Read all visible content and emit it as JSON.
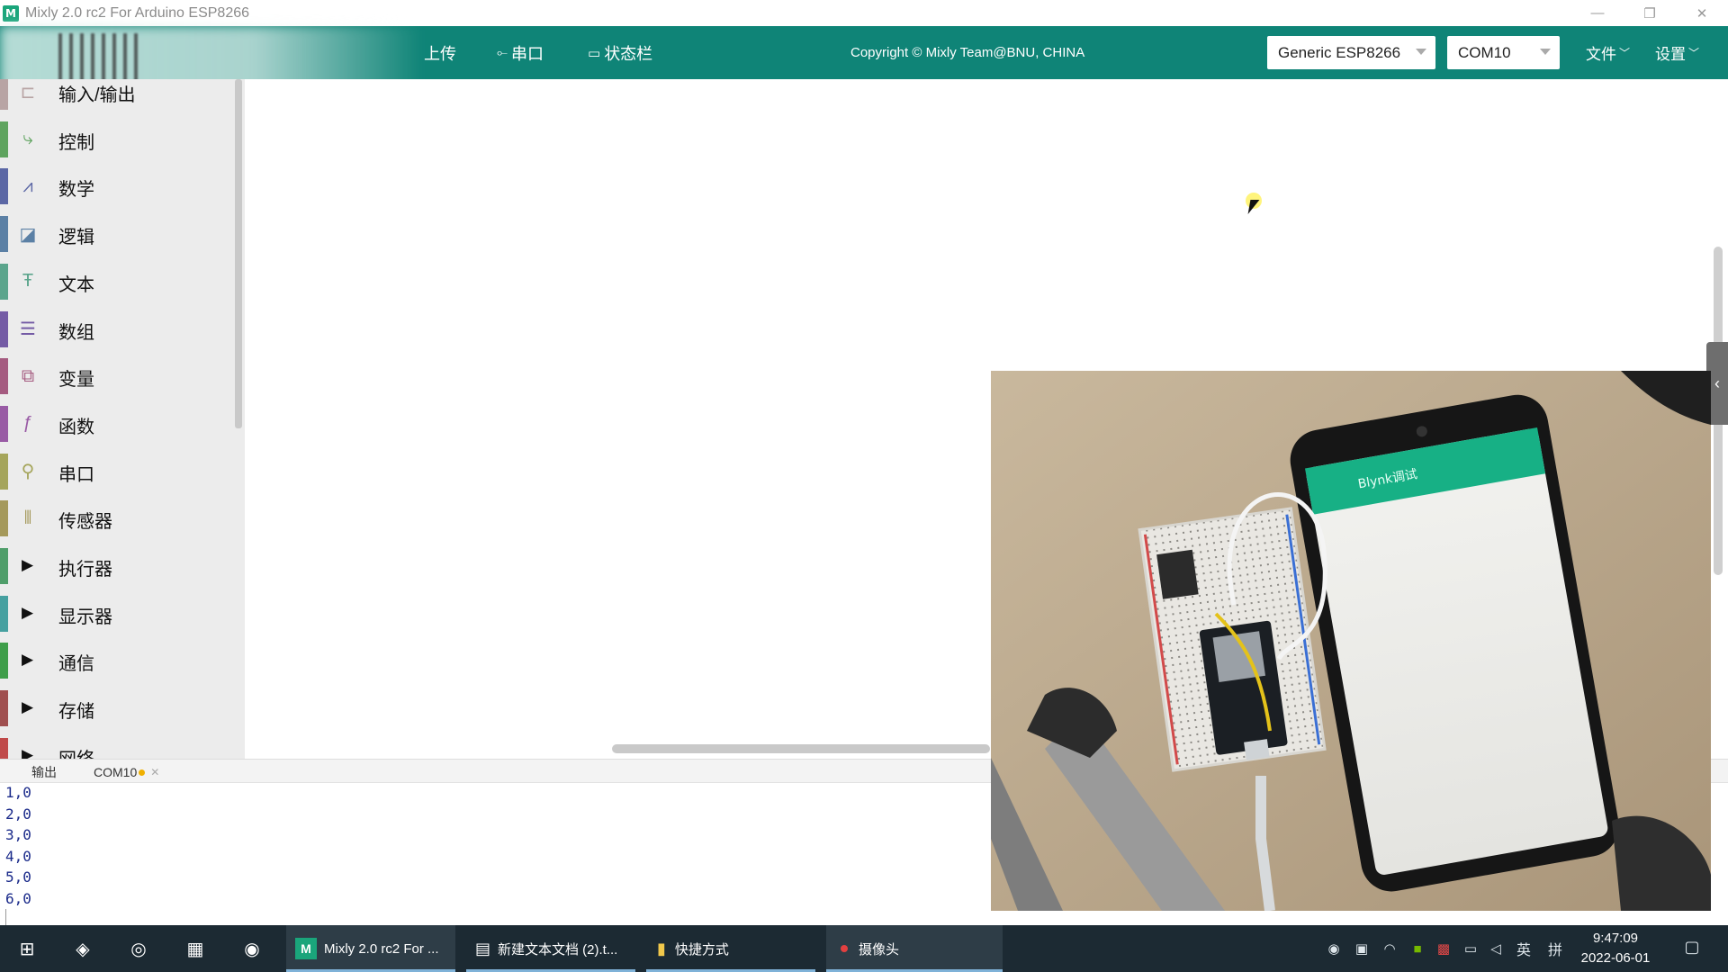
{
  "window": {
    "title": "Mixly 2.0 rc2 For Arduino ESP8266",
    "app_icon": "M",
    "controls": {
      "minimize": "—",
      "restore": "❐",
      "close": "✕"
    }
  },
  "toolbar": {
    "upload_label": "上传",
    "serial_label": "串口",
    "statusbar_label": "状态栏",
    "copyright": "Copyright © Mixly Team@BNU, CHINA",
    "board_select": "Generic ESP8266",
    "port_select": "COM10",
    "file_menu": "文件",
    "settings_menu": "设置",
    "accent_color": "#0f8477"
  },
  "sidebar": {
    "categories": [
      {
        "label": "输入/输出",
        "color": "#b8a4a4",
        "icon": "io-icon",
        "expandable": false
      },
      {
        "label": "控制",
        "color": "#5fa45f",
        "icon": "control-icon",
        "expandable": false
      },
      {
        "label": "数学",
        "color": "#5b67a5",
        "icon": "math-icon",
        "expandable": false
      },
      {
        "label": "逻辑",
        "color": "#5b80a5",
        "icon": "logic-icon",
        "expandable": false
      },
      {
        "label": "文本",
        "color": "#5ba58c",
        "icon": "text-icon",
        "expandable": false
      },
      {
        "label": "数组",
        "color": "#745ba5",
        "icon": "array-icon",
        "expandable": false
      },
      {
        "label": "变量",
        "color": "#a55b80",
        "icon": "variable-icon",
        "expandable": false
      },
      {
        "label": "函数",
        "color": "#995ba5",
        "icon": "function-icon",
        "expandable": false
      },
      {
        "label": "串口",
        "color": "#a5a55b",
        "icon": "serial-icon",
        "expandable": false
      },
      {
        "label": "传感器",
        "color": "#a5995b",
        "icon": "sensor-icon",
        "expandable": false
      },
      {
        "label": "执行器",
        "color": "#4f9e6a",
        "icon": "expand-triangle-icon",
        "expandable": true
      },
      {
        "label": "显示器",
        "color": "#46a0a0",
        "icon": "expand-triangle-icon",
        "expandable": true
      },
      {
        "label": "通信",
        "color": "#3f9e4a",
        "icon": "expand-triangle-icon",
        "expandable": true
      },
      {
        "label": "存储",
        "color": "#a05050",
        "icon": "expand-triangle-icon",
        "expandable": true
      },
      {
        "label": "网络",
        "color": "#c04a4a",
        "icon": "expand-triangle-icon",
        "expandable": true
      }
    ]
  },
  "output": {
    "tabs": [
      {
        "label": "输出"
      },
      {
        "label": "COM10",
        "modified": true
      }
    ],
    "lines": [
      "1,0",
      "2,0",
      "3,0",
      "4,0",
      "5,0",
      "6,0"
    ]
  },
  "camera": {
    "phone_app_title": "Blynk调试"
  },
  "taskbar": {
    "items": [
      {
        "label": "Mixly 2.0 rc2 For ...",
        "active": true
      },
      {
        "label": "新建文本文档 (2).t...",
        "active": false
      },
      {
        "label": "快捷方式",
        "active": false
      },
      {
        "label": "摄像头",
        "active": true
      }
    ],
    "tray": {
      "ime": "英",
      "ime_mode": "拼"
    },
    "time": "9:47:09",
    "date": "2022-06-01"
  }
}
